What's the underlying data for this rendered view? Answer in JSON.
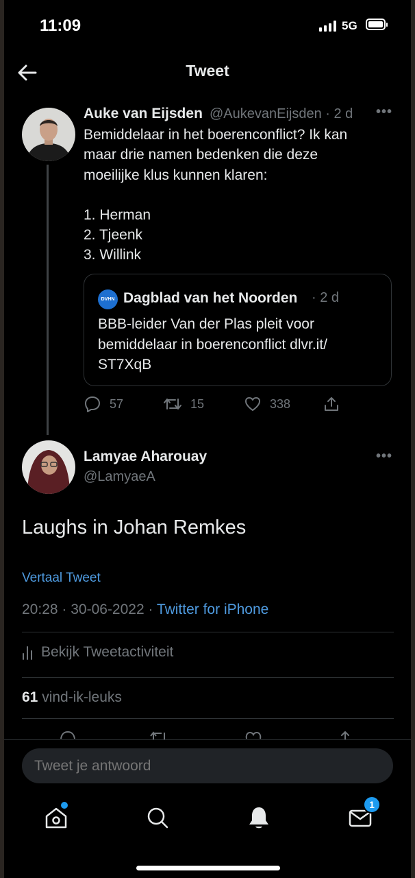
{
  "status_bar": {
    "time": "11:09",
    "network": "5G"
  },
  "header": {
    "title": "Tweet"
  },
  "parent_tweet": {
    "author_name": "Auke van Eijsden",
    "handle_and_time": "@AukevanEijsden · 2 d",
    "text_lines": [
      "Bemiddelaar in het boerenconflict? Ik kan",
      "maar drie namen bedenken die deze",
      "moeilijke klus kunnen klaren:",
      "",
      "1. Herman",
      "2. Tjeenk",
      "3. Willink"
    ],
    "quote": {
      "logo_text": "DVHN",
      "source_name": "Dagblad van het Noorden",
      "time": "· 2 d",
      "text_lines": [
        "BBB-leider Van der Plas pleit voor",
        "bemiddelaar in boerenconflict dlvr.it/",
        "ST7XqB"
      ]
    },
    "replies": "57",
    "retweets": "15",
    "likes": "338"
  },
  "main_tweet": {
    "author_name": "Lamyae Aharouay",
    "handle": "@LamyaeA",
    "text": "Laughs in Johan Remkes",
    "translate_label": "Vertaal Tweet",
    "timestamp": "20:28 · 30-06-2022 · ",
    "source": "Twitter for iPhone",
    "activity_label": "Bekijk Tweetactiviteit",
    "likes_count": "61",
    "likes_label": "vind-ik-leuks"
  },
  "reply_box": {
    "placeholder": "Tweet je antwoord"
  },
  "tab_bar": {
    "icons": [
      "home-icon",
      "search-icon",
      "notifications-icon",
      "messages-icon"
    ],
    "messages_badge": "1"
  },
  "colors": {
    "accent": "#1d9bf0",
    "link": "#4f9be0",
    "muted": "#71767b",
    "background": "#000000"
  }
}
